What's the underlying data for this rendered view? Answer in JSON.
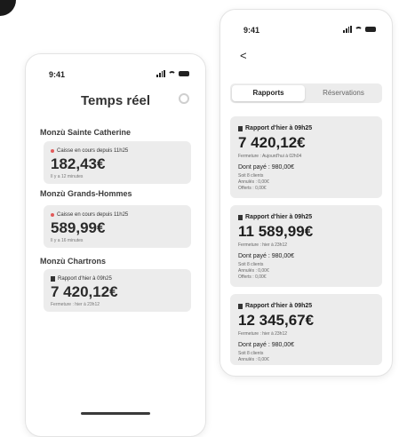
{
  "left": {
    "time": "9:41",
    "title": "Temps réel",
    "locations": [
      {
        "name": "Monzù Sainte Catherine",
        "caption": "Caisse en cours depuis 11h25",
        "amount": "182,43€",
        "sub": "Il y a 12 minutes"
      },
      {
        "name": "Monzù Grands-Hommes",
        "caption": "Caisse en cours depuis 11h25",
        "amount": "589,99€",
        "sub": "Il y a 16 minutes"
      },
      {
        "name": "Monzù Chartrons",
        "caption": "Rapport d'hier à 09h25",
        "amount": "7 420,12€",
        "sub": "Fermeture : hier à 23h12"
      }
    ]
  },
  "right": {
    "time": "9:41",
    "back": "<",
    "tabs": [
      "Rapports",
      "Réservations"
    ],
    "reports": [
      {
        "caption": "Rapport d'hier à 09h25",
        "amount": "7 420,12€",
        "closing": "Fermeture : Aujourd'hui à 02h04",
        "paid": "Dont payé : 980,00€",
        "clients": "Soit 8 clients",
        "cancelled": "Annulés : 0,00€",
        "offered": "Offerts : 0,00€"
      },
      {
        "caption": "Rapport d'hier à 09h25",
        "amount": "11 589,99€",
        "closing": "Fermeture : hier à 23h12",
        "paid": "Dont payé : 980,00€",
        "clients": "Soit 8 clients",
        "cancelled": "Annulés : 0,00€",
        "offered": "Offerts : 0,00€"
      },
      {
        "caption": "Rapport d'hier à 09h25",
        "amount": "12 345,67€",
        "closing": "Fermeture : hier à 23h12",
        "paid": "Dont payé : 980,00€",
        "clients": "Soit 8 clients",
        "cancelled": "Annulés : 0,00€"
      }
    ]
  }
}
